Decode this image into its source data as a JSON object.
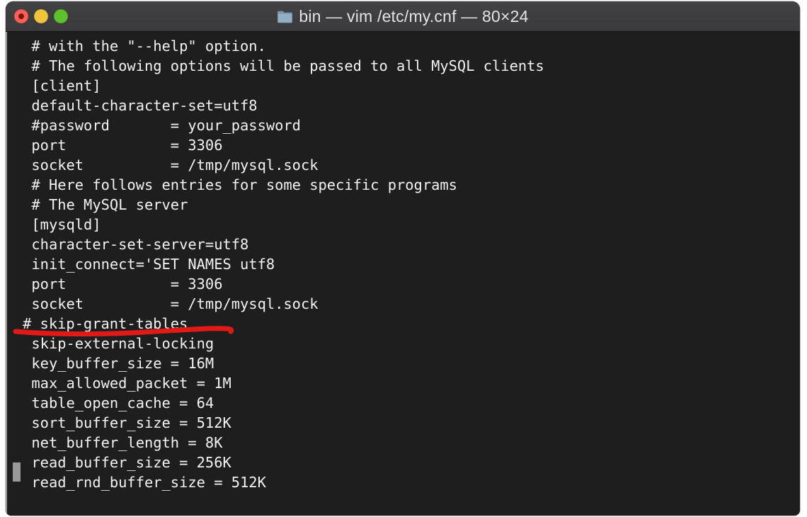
{
  "window": {
    "title": "bin — vim /etc/my.cnf — 80×24",
    "folder_icon": "folder-icon",
    "traffic_lights": [
      {
        "name": "close-button",
        "label": "Close",
        "color": "#ff5f57"
      },
      {
        "name": "minimize-button",
        "label": "Minimize",
        "color": "#f0c53c"
      },
      {
        "name": "maximize-button",
        "label": "Maximize",
        "color": "#5dc02c"
      }
    ],
    "titlebar_color": "#3c3c3e",
    "terminal_background": "#1e1e1e",
    "terminal_foreground": "#f2f2f2"
  },
  "terminal": {
    "app": "vim",
    "file": "/etc/my.cnf",
    "size": "80×24",
    "lines": [
      "# with the \"--help\" option.",
      "# The following options will be passed to all MySQL clients",
      "[client]",
      "default-character-set=utf8",
      "#password       = your_password",
      "port            = 3306",
      "socket          = /tmp/mysql.sock",
      "# Here follows entries for some specific programs",
      "# The MySQL server",
      "[mysqld]",
      "character-set-server=utf8",
      "init_connect='SET NAMES utf8",
      "port            = 3306",
      "socket          = /tmp/mysql.sock",
      "# skip-grant-tables",
      "skip-external-locking",
      "key_buffer_size = 16M",
      "max_allowed_packet = 1M",
      "table_open_cache = 64",
      "sort_buffer_size = 512K",
      "net_buffer_length = 8K",
      "read_buffer_size = 256K",
      "read_rnd_buffer_size = 512K"
    ],
    "outdented_line_index": 14,
    "cursor": {
      "name": "block-cursor",
      "line_index": 20,
      "color": "#9a9a9a"
    }
  },
  "annotation": {
    "name": "red-underline",
    "color": "#e01b17",
    "target_text": "# skip-grant-tables",
    "stroke_width": 7
  }
}
